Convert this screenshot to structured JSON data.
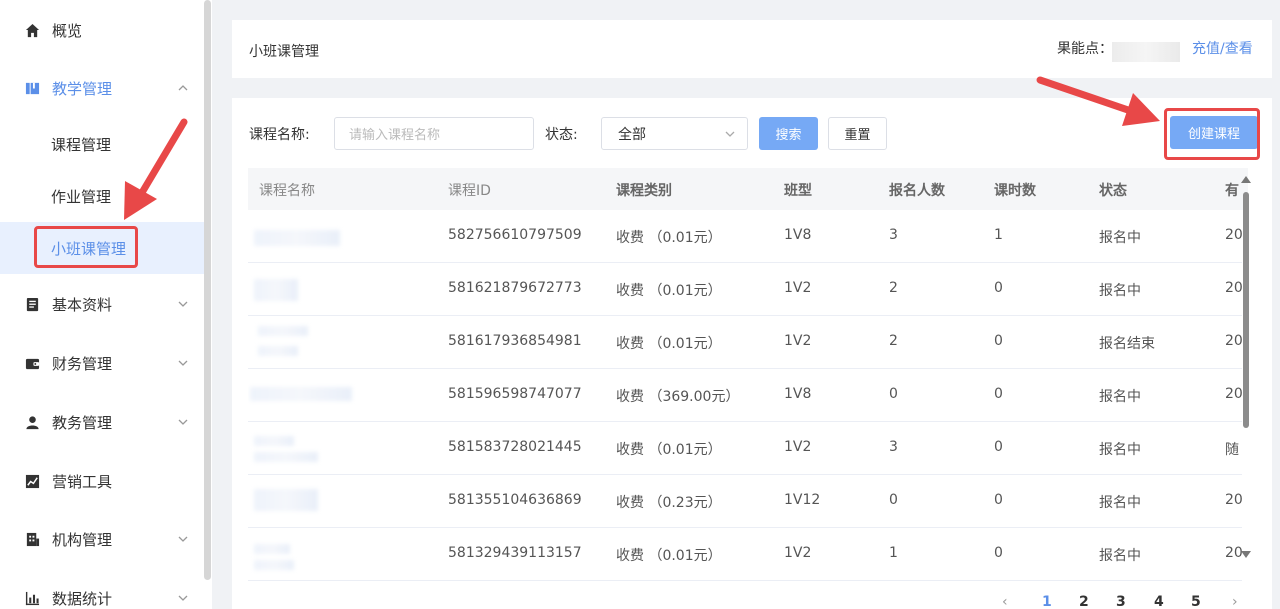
{
  "sidebar": {
    "items": [
      {
        "label": "概览",
        "icon": "home-icon"
      },
      {
        "label": "教学管理",
        "icon": "book-icon"
      },
      {
        "label": "基本资料",
        "icon": "document-icon"
      },
      {
        "label": "财务管理",
        "icon": "wallet-icon"
      },
      {
        "label": "教务管理",
        "icon": "user-icon"
      },
      {
        "label": "营销工具",
        "icon": "trend-chart-icon"
      },
      {
        "label": "机构管理",
        "icon": "building-icon"
      },
      {
        "label": "数据统计",
        "icon": "bar-chart-icon"
      }
    ],
    "sub_items": [
      {
        "label": "课程管理"
      },
      {
        "label": "作业管理"
      },
      {
        "label": "小班课管理"
      }
    ]
  },
  "header": {
    "title": "小班课管理",
    "balance_label": "果能点：",
    "recharge_link": "充值/查看"
  },
  "filters": {
    "course_name_label": "课程名称:",
    "course_name_placeholder": "请输入课程名称",
    "status_label": "状态:",
    "status_value": "全部",
    "search_button": "搜索",
    "reset_button": "重置",
    "create_button": "创建课程"
  },
  "table": {
    "columns": [
      "课程名称",
      "课程ID",
      "课程类别",
      "班型",
      "报名人数",
      "课时数",
      "状态",
      "有"
    ],
    "rows": [
      {
        "id": "582756610797509",
        "category": "收费",
        "price": "（0.01元）",
        "class_type": "1V8",
        "enrolled": "3",
        "lessons": "1",
        "status": "报名中",
        "extra": "20"
      },
      {
        "id": "581621879672773",
        "category": "收费",
        "price": "（0.01元）",
        "class_type": "1V2",
        "enrolled": "2",
        "lessons": "0",
        "status": "报名中",
        "extra": "20"
      },
      {
        "id": "581617936854981",
        "category": "收费",
        "price": "（0.01元）",
        "class_type": "1V2",
        "enrolled": "2",
        "lessons": "0",
        "status": "报名结束",
        "extra": "20"
      },
      {
        "id": "581596598747077",
        "category": "收费",
        "price": "（369.00元）",
        "class_type": "1V8",
        "enrolled": "0",
        "lessons": "0",
        "status": "报名中",
        "extra": "20"
      },
      {
        "id": "581583728021445",
        "category": "收费",
        "price": "（0.01元）",
        "class_type": "1V2",
        "enrolled": "3",
        "lessons": "0",
        "status": "报名中",
        "extra": "随"
      },
      {
        "id": "581355104636869",
        "category": "收费",
        "price": "（0.23元）",
        "class_type": "1V12",
        "enrolled": "0",
        "lessons": "0",
        "status": "报名中",
        "extra": "20"
      },
      {
        "id": "581329439113157",
        "category": "收费",
        "price": "（0.01元）",
        "class_type": "1V2",
        "enrolled": "1",
        "lessons": "0",
        "status": "报名中",
        "extra": "20"
      }
    ]
  },
  "pagination": {
    "pages": [
      "1",
      "2",
      "3",
      "4",
      "5"
    ],
    "current": "1"
  },
  "colors": {
    "accent": "#5b8fe8",
    "button_primary": "#76a9f5",
    "annotation_red": "#e84848"
  }
}
